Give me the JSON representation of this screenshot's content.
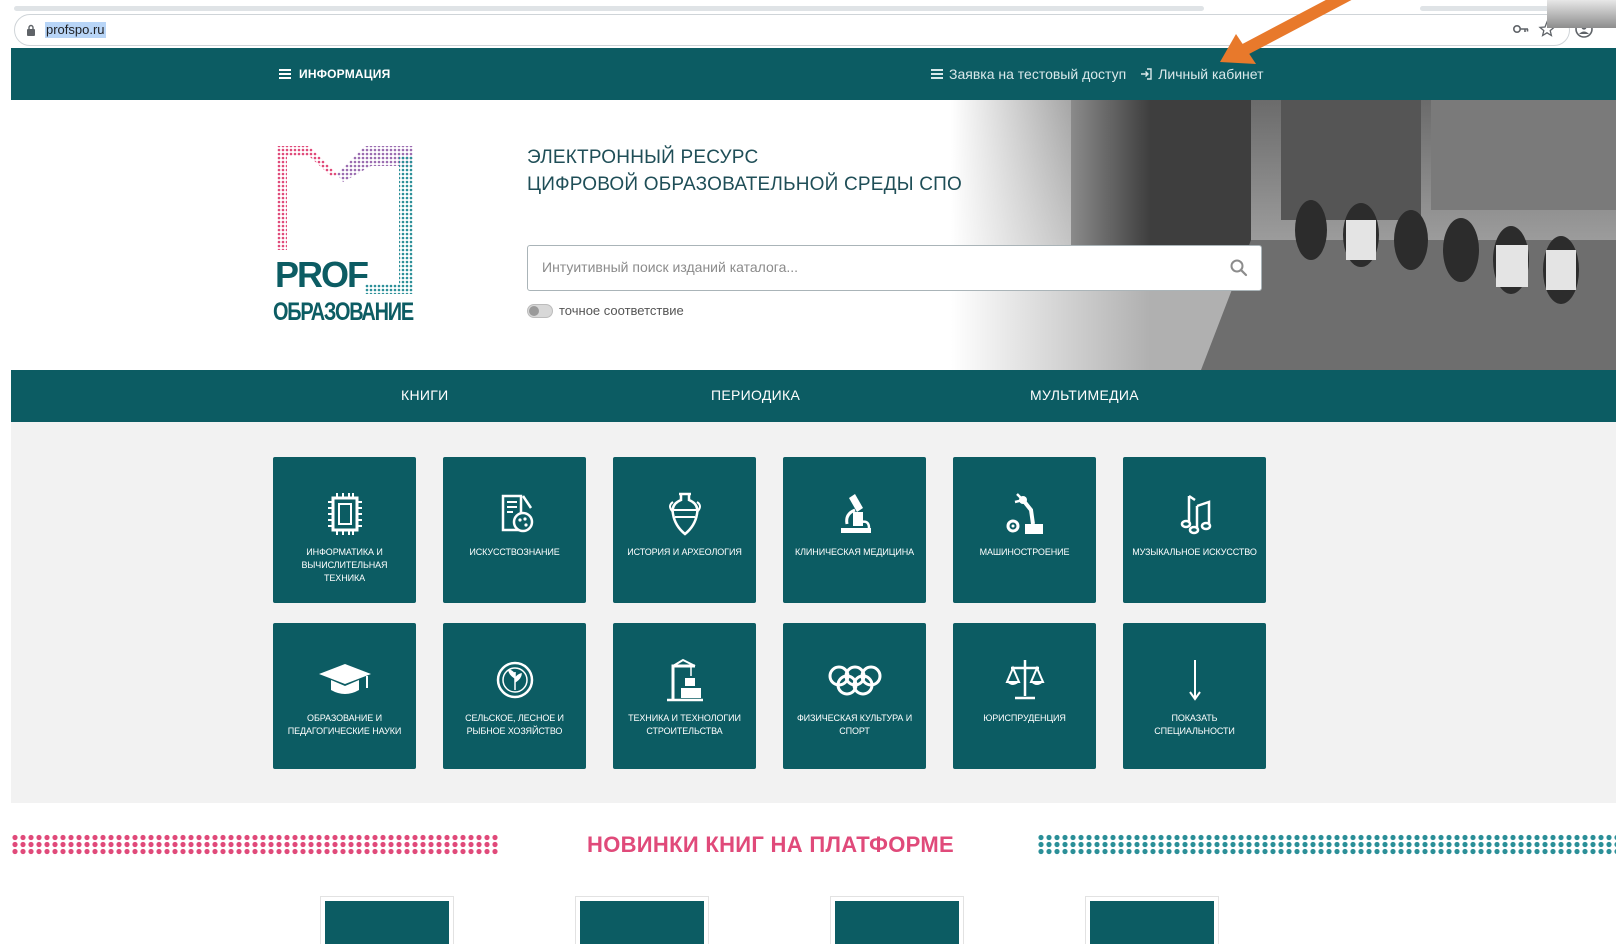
{
  "browser": {
    "url": "profspo.ru"
  },
  "topnav": {
    "info_label": "ИНФОРМАЦИЯ",
    "trial_label": "Заявка на тестовый доступ",
    "cabinet_label": "Личный кабинет"
  },
  "hero": {
    "title_line1": "ЭЛЕКТРОННЫЙ РЕСУРС",
    "title_line2": "ЦИФРОВОЙ ОБРАЗОВАТЕЛЬНОЙ СРЕДЫ СПО",
    "search_placeholder": "Интуитивный поиск изданий каталога...",
    "search_value": "",
    "exact_match_label": "точное соответствие",
    "exact_match_on": false,
    "logo_text_top": "PROF",
    "logo_text_bottom": "ОБРАЗОВАНИЕ"
  },
  "section_tabs": [
    {
      "label": "КНИГИ"
    },
    {
      "label": "ПЕРИОДИКА"
    },
    {
      "label": "МУЛЬТИМЕДИА"
    }
  ],
  "categories": [
    {
      "label": "ИНФОРМАТИКА И ВЫЧИСЛИТЕЛЬНАЯ ТЕХНИКА",
      "icon": "chip-icon"
    },
    {
      "label": "ИСКУССТВОЗНАНИЕ",
      "icon": "palette-book-icon"
    },
    {
      "label": "ИСТОРИЯ И АРХЕОЛОГИЯ",
      "icon": "amphora-icon"
    },
    {
      "label": "КЛИНИЧЕСКАЯ МЕДИЦИНА",
      "icon": "microscope-icon"
    },
    {
      "label": "МАШИНОСТРОЕНИЕ",
      "icon": "robot-arm-icon"
    },
    {
      "label": "МУЗЫКАЛЬНОЕ ИСКУССТВО",
      "icon": "music-notes-icon"
    },
    {
      "label": "ОБРАЗОВАНИЕ И ПЕДАГОГИЧЕСКИЕ НАУКИ",
      "icon": "graduation-cap-icon"
    },
    {
      "label": "СЕЛЬСКОЕ, ЛЕСНОЕ И РЫБНОЕ ХОЗЯЙСТВО",
      "icon": "leaf-emblem-icon"
    },
    {
      "label": "ТЕХНИКА И ТЕХНОЛОГИИ СТРОИТЕЛЬСТВА",
      "icon": "crane-icon"
    },
    {
      "label": "ФИЗИЧЕСКАЯ КУЛЬТУРА И СПОРТ",
      "icon": "olympic-rings-icon"
    },
    {
      "label": "ЮРИСПРУДЕНЦИЯ",
      "icon": "scales-icon"
    },
    {
      "label": "ПОКАЗАТЬ СПЕЦИАЛЬНОСТИ",
      "icon": "arrow-down-icon"
    }
  ],
  "new_books": {
    "title": "НОВИНКИ КНИГ НА ПЛАТФОРМЕ"
  },
  "colors": {
    "brand_teal": "#0c5c63",
    "accent_pink": "#e04a7a",
    "annotation_orange": "#e8792b"
  }
}
